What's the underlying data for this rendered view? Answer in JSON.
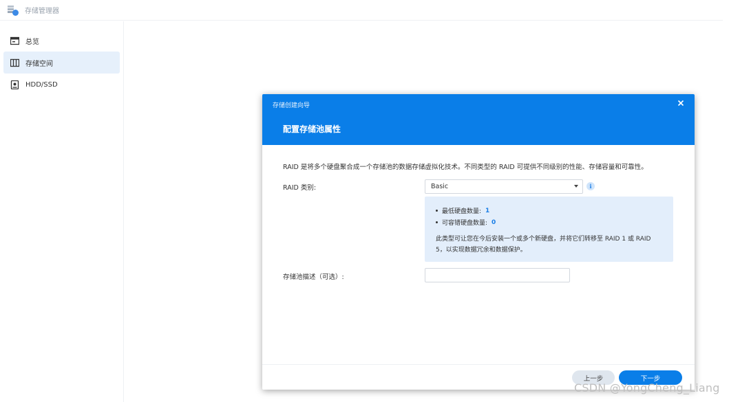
{
  "app": {
    "title": "存储管理器"
  },
  "sidebar": {
    "items": [
      {
        "label": "总览",
        "icon": "overview-icon",
        "active": false
      },
      {
        "label": "存储空间",
        "icon": "storage-space-icon",
        "active": true
      },
      {
        "label": "HDD/SSD",
        "icon": "disk-icon",
        "active": false
      }
    ]
  },
  "dialog": {
    "wizard_title": "存储创建向导",
    "step_title": "配置存储池属性",
    "description": "RAID 是将多个硬盘聚合成一个存储池的数据存储虚拟化技术。不同类型的 RAID 可提供不同级别的性能、存储容量和可靠性。",
    "raid_type_label": "RAID 类别:",
    "raid_type_value": "Basic",
    "info_icon_text": "i",
    "info": {
      "min_disks_label": "最低硬盘数量:",
      "min_disks_value": "1",
      "fault_tolerance_label": "可容错硬盘数量:",
      "fault_tolerance_value": "0",
      "note": "此类型可让您在今后安装一个或多个新硬盘，并将它们转移至 RAID 1 或 RAID 5，以实现数据冗余和数据保护。"
    },
    "pool_desc_label": "存储池描述（可选）:",
    "pool_desc_value": "",
    "prev_button": "上一步",
    "next_button": "下一步",
    "close_icon": "✕"
  },
  "watermark": "CSDN @YongCheng_Liang",
  "colors": {
    "accent": "#0a7ee8",
    "active_nav_bg": "#e6f0fb",
    "info_panel_bg": "#e3eefb"
  }
}
